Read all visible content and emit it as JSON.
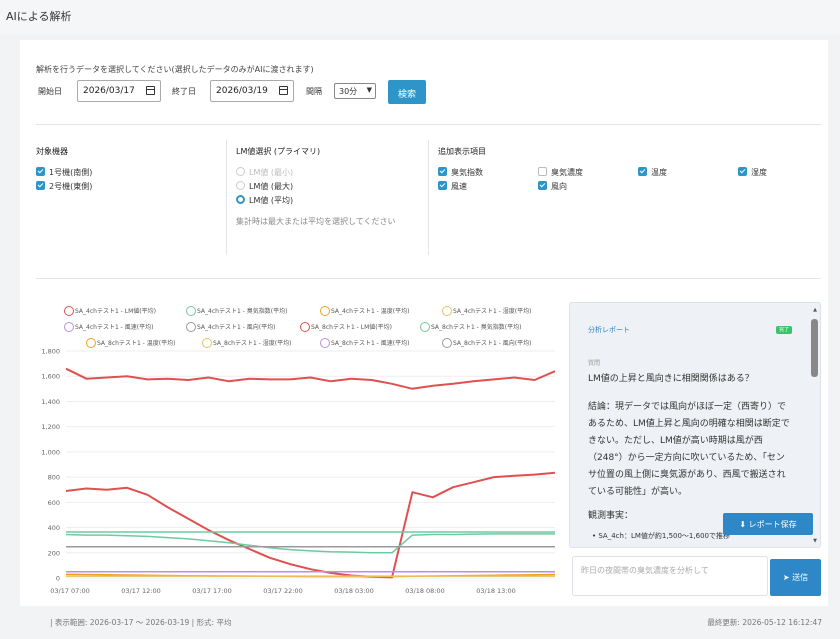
{
  "page": {
    "title": "AIによる解析"
  },
  "filter": {
    "instruction": "解析を行うデータを選択してください(選択したデータのみがAIに渡されます)",
    "start_label": "開始日",
    "start_value": "2026/03/17",
    "end_label": "終了日",
    "end_value": "2026/03/19",
    "interval_label": "間隔",
    "interval_value": "30分",
    "search_label": "検索"
  },
  "devices": {
    "title": "対象機器",
    "items": [
      {
        "label": "1号機(南側)",
        "checked": true
      },
      {
        "label": "2号機(東側)",
        "checked": true
      }
    ]
  },
  "lm": {
    "title": "LM値選択 (プライマリ)",
    "options": [
      {
        "label": "LM値 (最小)",
        "state": "disabled"
      },
      {
        "label": "LM値 (最大)",
        "state": "off"
      },
      {
        "label": "LM値 (平均)",
        "state": "on"
      }
    ],
    "hint": "集計時は最大または平均を選択してください"
  },
  "extras": {
    "title": "追加表示項目",
    "items": [
      {
        "label": "臭気指数",
        "checked": true
      },
      {
        "label": "臭気濃度",
        "checked": false
      },
      {
        "label": "温度",
        "checked": true
      },
      {
        "label": "湿度",
        "checked": true
      },
      {
        "label": "風速",
        "checked": true
      },
      {
        "label": "風向",
        "checked": true
      }
    ]
  },
  "colors": {
    "red": "#e05050",
    "green": "#6ccba0",
    "orange": "#f0a020",
    "gold": "#e8c060",
    "purple": "#b88ee8",
    "gray": "#9a9a9a",
    "accent": "#2e95c9"
  },
  "chart_data": {
    "type": "line",
    "legend": [
      {
        "name": "SA_4chテスト1 - LM値(平均)",
        "color": "#e05050"
      },
      {
        "name": "SA_4chテスト1 - 臭気指数(平均)",
        "color": "#6ccba0"
      },
      {
        "name": "SA_4chテスト1 - 温度(平均)",
        "color": "#f0a020"
      },
      {
        "name": "SA_4chテスト1 - 湿度(平均)",
        "color": "#e8c060"
      },
      {
        "name": "SA_4chテスト1 - 風速(平均)",
        "color": "#b88ee8"
      },
      {
        "name": "SA_4chテスト1 - 風向(平均)",
        "color": "#9a9a9a"
      },
      {
        "name": "SA_8chテスト1 - LM値(平均)",
        "color": "#e05050"
      },
      {
        "name": "SA_8chテスト1 - 臭気指数(平均)",
        "color": "#6ccba0"
      },
      {
        "name": "SA_8chテスト1 - 温度(平均)",
        "color": "#f0a020"
      },
      {
        "name": "SA_8chテスト1 - 湿度(平均)",
        "color": "#e8c060"
      },
      {
        "name": "SA_8chテスト1 - 風速(平均)",
        "color": "#b88ee8"
      },
      {
        "name": "SA_8chテスト1 - 風向(平均)",
        "color": "#9a9a9a"
      }
    ],
    "x_ticks": [
      "03/17 07:00",
      "03/17 12:00",
      "03/17 17:00",
      "03/17 22:00",
      "03/18 03:00",
      "03/18 08:00",
      "03/18 13:00"
    ],
    "y_ticks": [
      "0",
      "200",
      "400",
      "600",
      "800",
      "1,000",
      "1,200",
      "1,400",
      "1,600",
      "1,800"
    ],
    "ylim": [
      0,
      1800
    ],
    "x": [
      0,
      1,
      2,
      3,
      4,
      5,
      6,
      7,
      8,
      9,
      10,
      11,
      12,
      13,
      14,
      15,
      16,
      17,
      18,
      19,
      20,
      21,
      22,
      23,
      24
    ],
    "series": [
      {
        "name": "SA_4chテスト1 - LM値(平均)",
        "color": "#e05050",
        "values": [
          1660,
          1580,
          1590,
          1600,
          1575,
          1580,
          1570,
          1590,
          1560,
          1580,
          1575,
          1575,
          1590,
          1560,
          1580,
          1570,
          1540,
          1500,
          1525,
          1540,
          1560,
          1575,
          1590,
          1570,
          1640
        ]
      },
      {
        "name": "SA_8chテスト1 - LM値(平均)",
        "color": "#e05050",
        "values": [
          690,
          710,
          700,
          715,
          660,
          560,
          470,
          380,
          300,
          230,
          160,
          110,
          70,
          40,
          20,
          10,
          5,
          680,
          640,
          720,
          760,
          800,
          810,
          820,
          835
        ]
      },
      {
        "name": "SA_4chテスト1 - 臭気指数(平均)",
        "color": "#6ccba0",
        "values": [
          365,
          365,
          365,
          365,
          365,
          365,
          365,
          365,
          365,
          365,
          365,
          365,
          365,
          365,
          365,
          365,
          365,
          365,
          365,
          365,
          365,
          365,
          365,
          365,
          365
        ]
      },
      {
        "name": "SA_8chテスト1 - 臭気指数(平均)",
        "color": "#6ccba0",
        "values": [
          345,
          340,
          340,
          335,
          330,
          320,
          310,
          295,
          280,
          260,
          240,
          225,
          215,
          208,
          205,
          200,
          200,
          340,
          345,
          345,
          348,
          350,
          350,
          350,
          350
        ]
      },
      {
        "name": "SA_4chテスト1 - 風向(平均)",
        "color": "#9a9a9a",
        "values": [
          248,
          248,
          248,
          248,
          248,
          248,
          248,
          248,
          248,
          248,
          248,
          248,
          248,
          248,
          248,
          248,
          248,
          248,
          248,
          248,
          248,
          248,
          248,
          248,
          248
        ]
      },
      {
        "name": "SA_4chテスト1 - 風速(平均)",
        "color": "#b88ee8",
        "values": [
          50,
          50,
          50,
          50,
          50,
          50,
          50,
          50,
          50,
          50,
          50,
          50,
          50,
          50,
          50,
          50,
          50,
          50,
          50,
          50,
          50,
          50,
          50,
          50,
          50
        ]
      },
      {
        "name": "SA_4chテスト1 - 温度(平均)",
        "color": "#f0a020",
        "values": [
          30,
          28,
          26,
          24,
          22,
          20,
          18,
          17,
          16,
          15,
          14,
          13,
          12,
          12,
          12,
          12,
          12,
          14,
          16,
          18,
          20,
          22,
          24,
          26,
          28
        ]
      },
      {
        "name": "SA_4chテスト1 - 湿度(平均)",
        "color": "#e8c060",
        "values": [
          15,
          15,
          15,
          15,
          15,
          15,
          15,
          15,
          15,
          15,
          15,
          15,
          15,
          15,
          15,
          15,
          15,
          15,
          15,
          15,
          15,
          15,
          15,
          15,
          15
        ]
      }
    ]
  },
  "report": {
    "title": "分析レポート",
    "badge": "完了",
    "question_label": "質問",
    "question": "LM値の上昇と風向きに相関関係はある？",
    "body": "結論：現データでは風向がほぼ一定（西寄り）であるため、LM値上昇と風向の明確な相関は断定できない。ただし、LM値が高い時期は風が西（248°）から一定方向に吹いているため、「センサ位置の風上側に臭気源があり、西風で搬送されている可能性」が高い。",
    "observations_title": "観測事実：",
    "observation_1": "• SA_4ch：LM値が約1,500〜1,600で推移"
  },
  "actions": {
    "save_label": "レポート保存",
    "ask_placeholder": "昨日の夜間帯の臭気濃度を分析して",
    "send_label": "送信"
  },
  "footer": {
    "range": "| 表示範囲: 2026-03-17 ～ 2026-03-19 | 形式: 平均",
    "updated": "最終更新: 2026-05-12 16:12:47"
  }
}
